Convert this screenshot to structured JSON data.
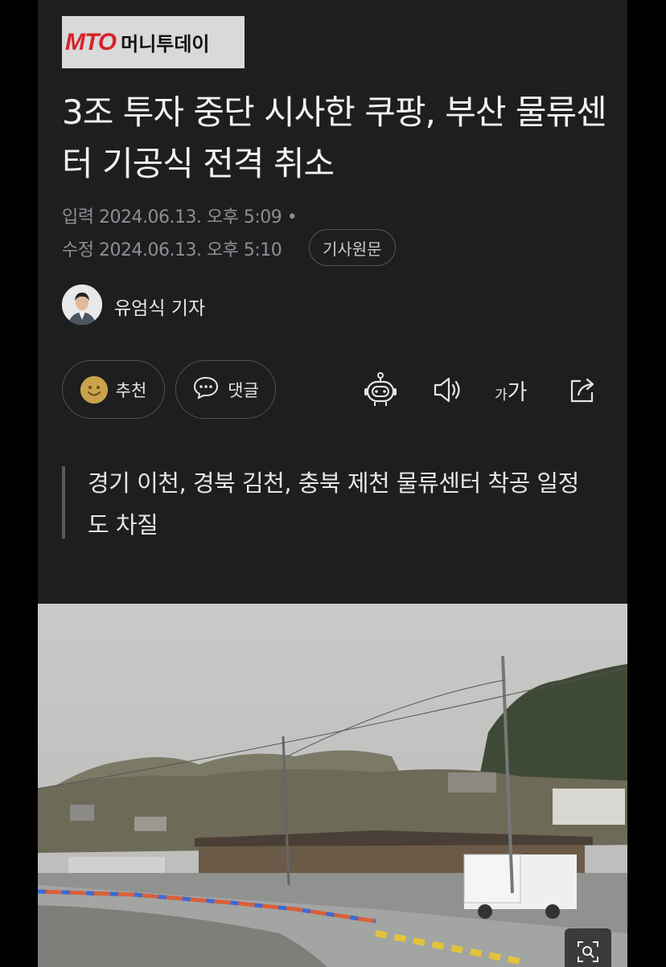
{
  "publisher": {
    "logo_mark": "MTO",
    "logo_text": "머니투데이"
  },
  "article": {
    "headline": "3조 투자 중단 시사한 쿠팡, 부산 물류센터 기공식 전격 취소",
    "published": "입력 2024.06.13. 오후 5:09 •",
    "modified": "수정 2024.06.13. 오후 5:10",
    "original_link": "기사원문",
    "reporter": "유엄식 기자",
    "subheading": "경기 이천, 경북 김천, 충북 제천 물류센터 착공 일정도 차질"
  },
  "actions": {
    "like_label": "추천",
    "comment_label": "댓글",
    "font_small": "가",
    "font_large": "가"
  },
  "icons": [
    "smile-icon",
    "speech-bubble-icon",
    "robot-icon",
    "speaker-icon",
    "share-icon",
    "zoom-icon"
  ],
  "colors": {
    "background": "#1e1e20",
    "logo_red": "#d8232a",
    "text": "#f2f2f2",
    "muted": "#8e8e93"
  }
}
